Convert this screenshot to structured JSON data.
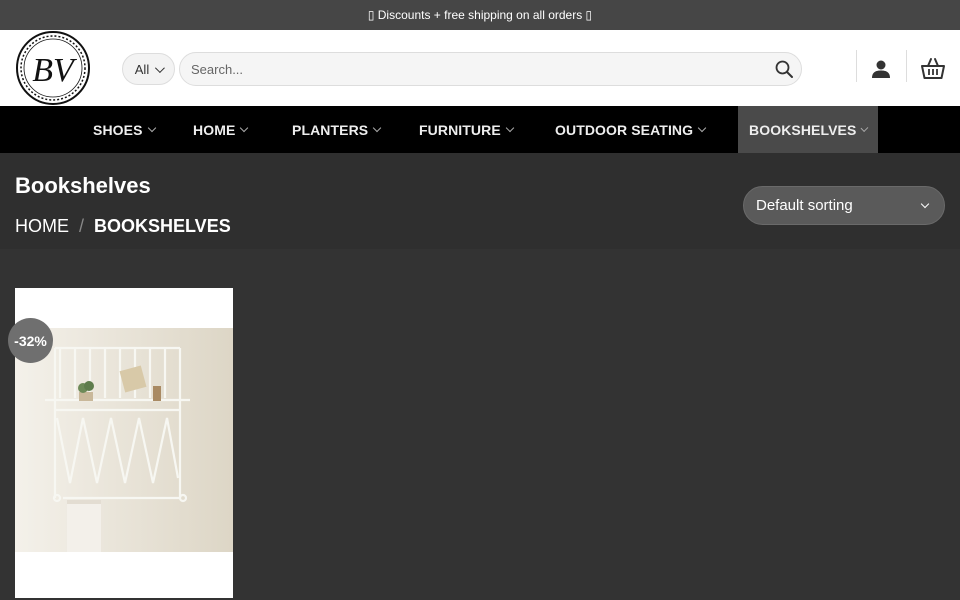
{
  "topbar": {
    "text": "▯ Discounts + free shipping on all orders ▯"
  },
  "header": {
    "logo_text": "BV",
    "category_select": "All",
    "search_placeholder": "Search..."
  },
  "nav": {
    "items": [
      {
        "label": "SHOES"
      },
      {
        "label": "HOME"
      },
      {
        "label": "PLANTERS"
      },
      {
        "label": "FURNITURE"
      },
      {
        "label": "OUTDOOR SEATING"
      },
      {
        "label": "BOOKSHELVES"
      }
    ],
    "active": "BOOKSHELVES"
  },
  "page": {
    "title": "Bookshelves",
    "breadcrumb": {
      "home": "HOME",
      "separator": "/",
      "current": "BOOKSHELVES"
    },
    "sorting": "Default sorting"
  },
  "products": [
    {
      "badge": "-32%"
    }
  ],
  "colors": {
    "topbar_bg": "#464646",
    "nav_bg": "#000000",
    "nav_active_bg": "#4a4a4a",
    "page_bg": "#333333",
    "badge_bg": "#6f6f6f"
  },
  "icons": {
    "search": "search-icon",
    "account": "user-icon",
    "cart": "basket-icon"
  }
}
